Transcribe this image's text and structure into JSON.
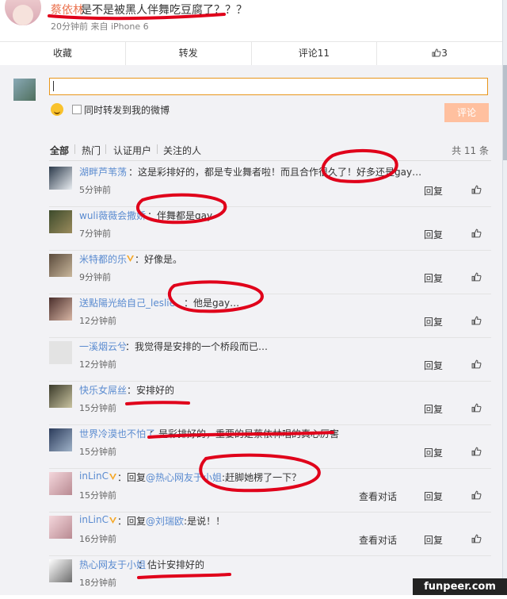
{
  "post": {
    "author": "蔡依林",
    "text": "是不是被黑人伴舞吃豆腐了？？？",
    "meta": "20分钟前 来自 iPhone 6"
  },
  "actions": {
    "favorite": "收藏",
    "repost": "转发",
    "comment": "评论11",
    "like_count": "3"
  },
  "composer": {
    "input_value": "",
    "also_repost": "同时转发到我的微博",
    "submit": "评论"
  },
  "filters": {
    "all": "全部",
    "hot": "热门",
    "verified": "认证用户",
    "following": "关注的人",
    "total": "共 11 条"
  },
  "comments": [
    {
      "name": "湖畔芦苇荡",
      "text": "：这是彩排好的，都是专业舞者啦！而且合作很久了！好多还是gay…",
      "time": "5分钟前",
      "reply": "回复"
    },
    {
      "name": "wuli薇薇会撒娇",
      "text": "：伴舞都是gay",
      "time": "7分钟前",
      "reply": "回复"
    },
    {
      "name": "米特都的乐",
      "text": "：好像是。",
      "time": "9分钟前",
      "reply": "回复"
    },
    {
      "name": "送點陽光給自己_leslie",
      "text": "：他是gay…",
      "time": "12分钟前",
      "reply": "回复"
    },
    {
      "name": "一溪烟云兮",
      "text": "：我觉得是安排的一个桥段而已…",
      "time": "12分钟前",
      "reply": "回复"
    },
    {
      "name": "快乐女屌丝",
      "text": "：安排好的",
      "time": "15分钟前",
      "reply": "回复"
    },
    {
      "name": "世界冷漠也不怕了",
      "text": "：是彩排好的，重要的是蔡依林唱的真心厉害",
      "time": "15分钟前",
      "reply": "回复"
    },
    {
      "name": "inLinC",
      "prefix": "：回复",
      "mention": "@热心网友于小姐",
      "text": ":赶脚她楞了一下？",
      "time": "15分钟前",
      "dialog": "查看对话",
      "reply": "回复"
    },
    {
      "name": "inLinC",
      "prefix": "：回复",
      "mention": "@刘瑞欧",
      "text": ":是说！！",
      "time": "16分钟前",
      "dialog": "查看对话",
      "reply": "回复"
    },
    {
      "name": "热心网友于小姐",
      "text": "：估计安排好的",
      "time": "18分钟前",
      "reply": "回复"
    }
  ],
  "watermark": "funpeer.com",
  "colors": {
    "author": "#eb7350",
    "link": "#5a8bd0",
    "annotation": "#e0001a",
    "submit": "#ffc09f"
  }
}
